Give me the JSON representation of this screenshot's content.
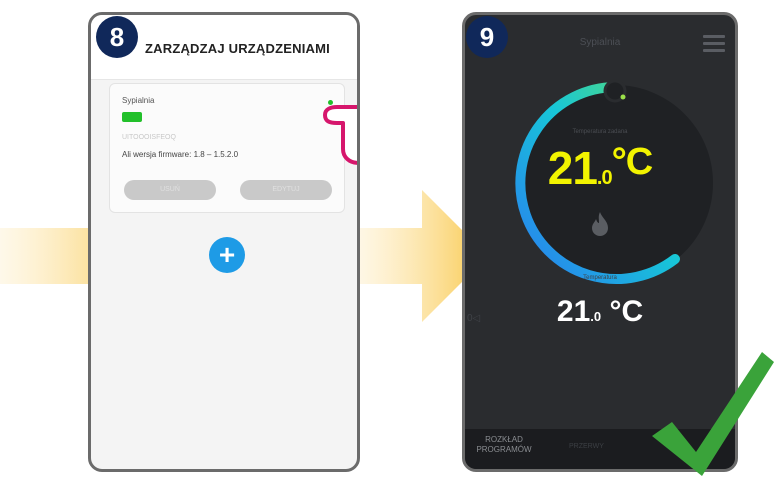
{
  "steps": {
    "step8": "8",
    "step9": "9"
  },
  "phone8": {
    "title": "ZARZĄDZAJ URZĄDZENIAMI",
    "device": {
      "name": "Sypialnia",
      "id": "UITOOOISFEOQ",
      "firmware": "Ali wersja firmware: 1.8 – 1.5.2.0",
      "button_left": "USUŃ",
      "button_right": "EDYTUJ"
    },
    "add_button": "+"
  },
  "phone9": {
    "header_title": "Sypialnia",
    "dial_label": "Temperatura zadana",
    "set_temp": {
      "whole": "21",
      "decimal": ".0",
      "unit": "°C"
    },
    "room_label": "Temperatura",
    "room_temp": {
      "whole": "21",
      "decimal": ".0",
      "unit": " °C"
    },
    "left_marker": "0◁",
    "tabs": {
      "schedule_line1": "ROZKŁAD",
      "schedule_line2": "PROGRAMÓW",
      "second": "PRZERWY"
    }
  },
  "icons": {
    "hand": "pointing-hand-icon",
    "flame": "flame-icon",
    "menu": "hamburger-menu-icon",
    "check": "green-check-icon",
    "arrow": "yellow-arrow-icon",
    "add": "plus-icon"
  },
  "colors": {
    "badge": "#10285a",
    "accent_green": "#22c02a",
    "add_blue": "#1e9be6",
    "temp_yellow": "#f2f300",
    "check_green": "#3aa33a",
    "hand_pink": "#d6166c",
    "arrow_yellow": "#f9c84a"
  }
}
